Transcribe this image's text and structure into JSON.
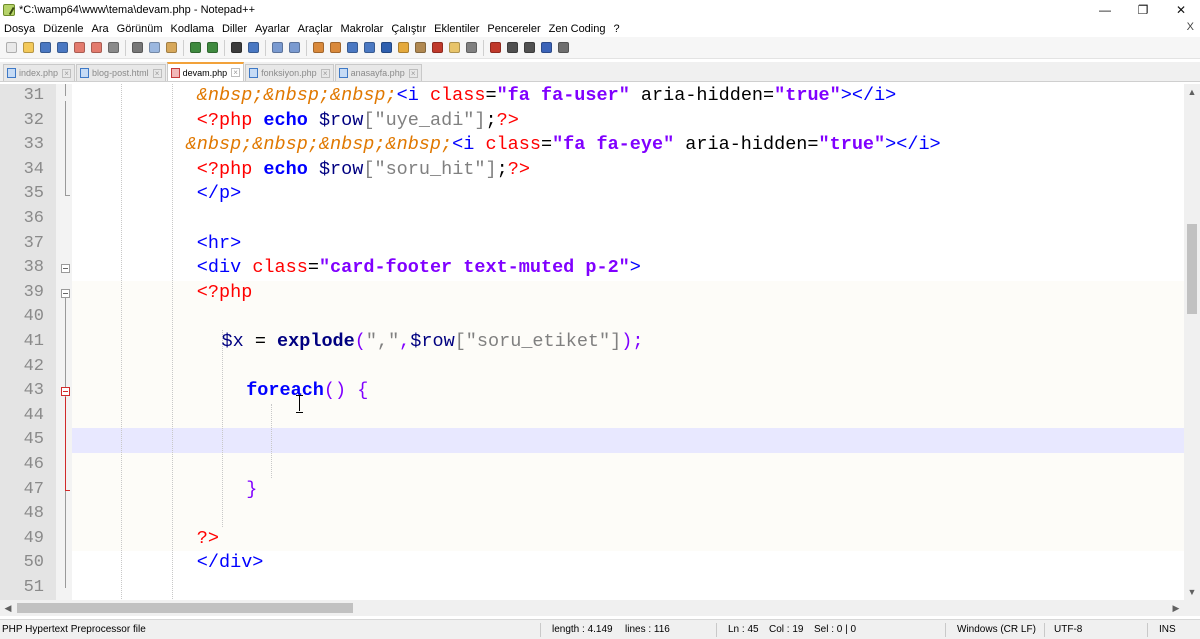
{
  "window": {
    "title": "*C:\\wamp64\\www\\tema\\devam.php - Notepad++",
    "controls": {
      "minimize": "—",
      "restore": "❐",
      "close": "✕"
    }
  },
  "menu": [
    "Dosya",
    "Düzenle",
    "Ara",
    "Görünüm",
    "Kodlama",
    "Diller",
    "Ayarlar",
    "Araçlar",
    "Makrolar",
    "Çalıştır",
    "Eklentiler",
    "Pencereler",
    "Zen Coding",
    "?"
  ],
  "menu_close": "X",
  "toolbar": [
    {
      "name": "new-file-icon",
      "color": "#e9e9e9"
    },
    {
      "name": "open-file-icon",
      "color": "#f3c95a"
    },
    {
      "name": "save-icon",
      "color": "#4a78c2"
    },
    {
      "name": "save-all-icon",
      "color": "#4a78c2"
    },
    {
      "name": "close-icon",
      "color": "#e37b6e"
    },
    {
      "name": "close-all-icon",
      "color": "#e37b6e"
    },
    {
      "name": "print-icon",
      "color": "#8a8a8a"
    },
    {
      "sep": true
    },
    {
      "name": "cut-icon",
      "color": "#777777"
    },
    {
      "name": "copy-icon",
      "color": "#9bb7df"
    },
    {
      "name": "paste-icon",
      "color": "#d7a85b"
    },
    {
      "sep": true
    },
    {
      "name": "undo-icon",
      "color": "#3f8a3f"
    },
    {
      "name": "redo-icon",
      "color": "#3f8a3f"
    },
    {
      "sep": true
    },
    {
      "name": "find-icon",
      "color": "#3c3c3c"
    },
    {
      "name": "replace-icon",
      "color": "#4a78c2"
    },
    {
      "sep": true
    },
    {
      "name": "zoom-in-icon",
      "color": "#7a9ad0"
    },
    {
      "name": "zoom-out-icon",
      "color": "#7a9ad0"
    },
    {
      "sep": true
    },
    {
      "name": "sync-v-icon",
      "color": "#d9893b"
    },
    {
      "name": "sync-h-icon",
      "color": "#d9893b"
    },
    {
      "name": "word-wrap-icon",
      "color": "#4a78c2"
    },
    {
      "name": "show-all-chars-icon",
      "color": "#4a78c2"
    },
    {
      "name": "indent-guide-icon",
      "color": "#2e5fae"
    },
    {
      "name": "udl-icon",
      "color": "#e4a93c"
    },
    {
      "name": "doc-map-icon",
      "color": "#b08850"
    },
    {
      "name": "function-list-icon",
      "color": "#c0392b"
    },
    {
      "name": "folder-workspace-icon",
      "color": "#e8c46a"
    },
    {
      "name": "monitoring-icon",
      "color": "#808080"
    },
    {
      "sep": true
    },
    {
      "name": "record-macro-icon",
      "color": "#c0392b"
    },
    {
      "name": "stop-macro-icon",
      "color": "#505050"
    },
    {
      "name": "play-macro-icon",
      "color": "#505050"
    },
    {
      "name": "play-multiple-icon",
      "color": "#3b63b8"
    },
    {
      "name": "save-macro-icon",
      "color": "#6f6f6f"
    }
  ],
  "tabs": [
    {
      "label": "index.php",
      "active": false
    },
    {
      "label": "blog-post.html",
      "active": false
    },
    {
      "label": "devam.php",
      "active": true
    },
    {
      "label": "fonksiyon.php",
      "active": false
    },
    {
      "label": "anasayfa.php",
      "active": false
    }
  ],
  "editor": {
    "lines": [
      {
        "n": "31",
        "indent": 5,
        "tokens": [
          [
            "ent",
            "&nbsp;&nbsp;&nbsp;"
          ],
          [
            "tag",
            "<i "
          ],
          [
            "attr",
            "class"
          ],
          [
            "plain",
            "="
          ],
          [
            "str",
            "\"fa fa-user\""
          ],
          [
            "plain",
            " aria-hidden="
          ],
          [
            "str",
            "\"true\""
          ],
          [
            "tag",
            "></i>"
          ]
        ]
      },
      {
        "n": "32",
        "indent": 5,
        "tokens": [
          [
            "php",
            "<?php "
          ],
          [
            "kw",
            "echo"
          ],
          [
            "plain",
            " "
          ],
          [
            "var",
            "$row"
          ],
          [
            "pstr",
            "[\"uye_adi\"]"
          ],
          [
            "plain",
            ";"
          ],
          [
            "php",
            "?>"
          ]
        ]
      },
      {
        "n": "33",
        "indent": 4.55,
        "tokens": [
          [
            "ent",
            "&nbsp;&nbsp;&nbsp;&nbsp;"
          ],
          [
            "tag",
            "<i "
          ],
          [
            "attr",
            "class"
          ],
          [
            "plain",
            "="
          ],
          [
            "str",
            "\"fa fa-eye\""
          ],
          [
            "plain",
            " aria-hidden="
          ],
          [
            "str",
            "\"true\""
          ],
          [
            "tag",
            "></i>"
          ]
        ]
      },
      {
        "n": "34",
        "indent": 5,
        "tokens": [
          [
            "php",
            "<?php "
          ],
          [
            "kw",
            "echo"
          ],
          [
            "plain",
            " "
          ],
          [
            "var",
            "$row"
          ],
          [
            "pstr",
            "[\"soru_hit\"]"
          ],
          [
            "plain",
            ";"
          ],
          [
            "php",
            "?>"
          ]
        ]
      },
      {
        "n": "35",
        "indent": 5,
        "tokens": [
          [
            "tag",
            "</p>"
          ]
        ]
      },
      {
        "n": "36",
        "indent": 0,
        "tokens": []
      },
      {
        "n": "37",
        "indent": 5,
        "tokens": [
          [
            "tag",
            "<hr>"
          ]
        ]
      },
      {
        "n": "38",
        "indent": 5,
        "tokens": [
          [
            "tag",
            "<div "
          ],
          [
            "attr",
            "class"
          ],
          [
            "plain",
            "="
          ],
          [
            "str",
            "\"card-footer text-muted p-2\""
          ],
          [
            "tag",
            ">"
          ]
        ]
      },
      {
        "n": "39",
        "indent": 5,
        "tokens": [
          [
            "php",
            "<?php"
          ]
        ]
      },
      {
        "n": "40",
        "indent": 0,
        "tokens": []
      },
      {
        "n": "41",
        "indent": 6,
        "tokens": [
          [
            "var",
            "$x"
          ],
          [
            "plain",
            " = "
          ],
          [
            "fn",
            "explode"
          ],
          [
            "op",
            "("
          ],
          [
            "pstr",
            "\",\""
          ],
          [
            "op",
            ","
          ],
          [
            "var",
            "$row"
          ],
          [
            "pstr",
            "[\"soru_etiket\"]"
          ],
          [
            "op",
            ");"
          ]
        ]
      },
      {
        "n": "42",
        "indent": 0,
        "tokens": []
      },
      {
        "n": "43",
        "indent": 7,
        "tokens": [
          [
            "kw",
            "foreach"
          ],
          [
            "op",
            "()"
          ],
          [
            "plain",
            " "
          ],
          [
            "op",
            "{"
          ]
        ]
      },
      {
        "n": "44",
        "indent": 0,
        "tokens": []
      },
      {
        "n": "45",
        "indent": 0,
        "tokens": []
      },
      {
        "n": "46",
        "indent": 0,
        "tokens": []
      },
      {
        "n": "47",
        "indent": 7,
        "tokens": [
          [
            "op",
            "}"
          ]
        ]
      },
      {
        "n": "48",
        "indent": 0,
        "tokens": []
      },
      {
        "n": "49",
        "indent": 5,
        "tokens": [
          [
            "php",
            "?>"
          ]
        ]
      },
      {
        "n": "50",
        "indent": 5,
        "tokens": [
          [
            "tag",
            "</div>"
          ]
        ]
      },
      {
        "n": "51",
        "indent": 0,
        "tokens": []
      }
    ],
    "current_line": "45"
  },
  "status": {
    "file_type": "PHP Hypertext Preprocessor file",
    "length": "length : 4.149",
    "lines": "lines : 116",
    "ln": "Ln : 45",
    "col": "Col : 19",
    "sel": "Sel : 0 | 0",
    "eol": "Windows (CR LF)",
    "encoding": "UTF-8",
    "mode": "INS"
  }
}
